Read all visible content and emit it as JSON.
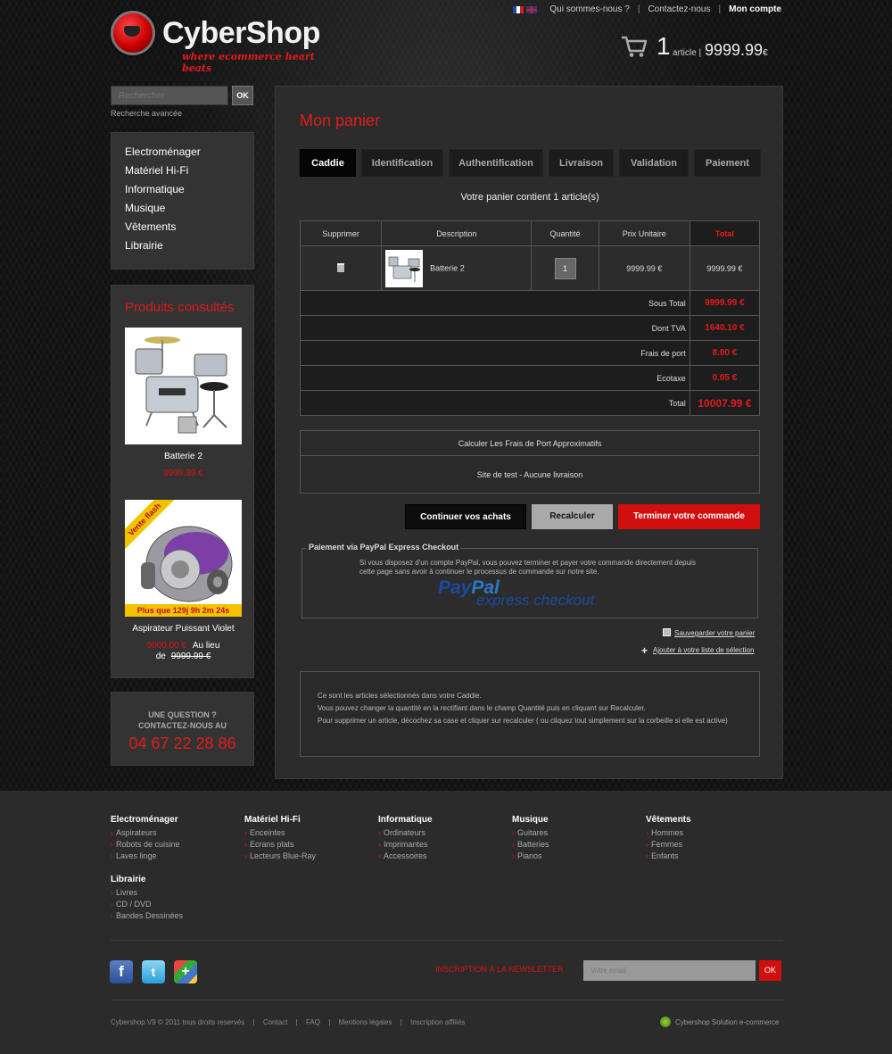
{
  "header": {
    "brand": "CyberShop",
    "tagline": "where ecommerce heart beats",
    "nav": [
      "Qui sommes-nous ?",
      "Contactez-nous",
      "Mon compte"
    ],
    "cart": {
      "count": "1",
      "word": "article |",
      "total": "9999.99",
      "currency": "€"
    }
  },
  "search": {
    "placeholder": "Rechercher",
    "button": "OK",
    "advanced": "Recherche avancée"
  },
  "categories": [
    "Electroménager",
    "Matériel Hi-Fi",
    "Informatique",
    "Musique",
    "Vêtements",
    "Librairie"
  ],
  "viewed": {
    "title": "Produits consultés",
    "items": [
      {
        "name": "Batterie 2",
        "price": "9999.99 €"
      },
      {
        "name": "Aspirateur Puissant Violet",
        "price": "9000.00 €",
        "au_lieu": "Au lieu",
        "de": "de",
        "old_price": "9999.99 €",
        "flash": "Vente flash",
        "countdown": "Plus que 129j 9h 2m 24s"
      }
    ]
  },
  "question": {
    "line1": "UNE QUESTION ?",
    "line2": "CONTACTEZ-NOUS AU",
    "phone": "04 67 22 28 86"
  },
  "main": {
    "title": "Mon panier",
    "steps": [
      "Caddie",
      "Identification",
      "Authentification",
      "Livraison",
      "Validation",
      "Paiement"
    ],
    "basket_count": "Votre panier contient 1 article(s)",
    "table": {
      "headers": [
        "Supprimer",
        "Description",
        "Quantité",
        "Prix Unitaire",
        "Total"
      ],
      "row": {
        "name": "Batterie 2",
        "qty": "1",
        "unit_price": "9999.99 €",
        "total": "9999.99 €"
      },
      "summary": [
        {
          "label": "Sous Total",
          "value": "9999.99 €"
        },
        {
          "label": "Dont TVA",
          "value": "1640.10 €"
        },
        {
          "label": "Frais de port",
          "value": "8.00 €"
        },
        {
          "label": "Ecotaxe",
          "value": "0.05 €"
        },
        {
          "label": "Total",
          "value": "10007.99 €"
        }
      ]
    },
    "shipping": {
      "title": "Calculer Les Frais de Port Approximatifs",
      "text": "Site de test - Aucune livraison"
    },
    "buttons": {
      "continue": "Continuer vos achats",
      "recalc": "Recalculer",
      "finish": "Terminer votre commande"
    },
    "paypal": {
      "title": "Paiement via PayPal Express Checkout",
      "text": "Si vous disposez d'un compte PayPal, vous pouvez terminer et payer votre commande directement depuis cette page sans avoir à continuer le processus de commande sur notre site.",
      "logo1": "Pay",
      "logo2": "Pal",
      "logo3": "express checkout"
    },
    "links": {
      "save": "Sauvegarder votre panier",
      "add": "Ajouter à votre liste de sélection"
    },
    "info": [
      "Ce sont les articles sélectionnés dans votre Caddie.",
      "Vous pouvez changer la quantité en la rectifiant dans le champ Quantité puis en cliquant sur Recalculer.",
      "Pour supprimer un article, décochez sa case et cliquer sur recalculer ( ou cliquez tout simplement sur la corbeille si elle est active)"
    ]
  },
  "footer": {
    "columns": [
      {
        "title": "Electroménager",
        "items": [
          "Aspirateurs",
          "Robots de cuisine",
          "Laves linge"
        ]
      },
      {
        "title": "Matériel Hi-Fi",
        "items": [
          "Enceintes",
          "Ecrans plats",
          "Lecteurs Blue-Ray"
        ]
      },
      {
        "title": "Informatique",
        "items": [
          "Ordinateurs",
          "Imprimantes",
          "Accessoires"
        ]
      },
      {
        "title": "Musique",
        "items": [
          "Guitares",
          "Batteries",
          "Pianos"
        ]
      },
      {
        "title": "Vêtements",
        "items": [
          "Hommes",
          "Femmes",
          "Enfants"
        ]
      },
      {
        "title": "Librairie",
        "items": [
          "Livres",
          "CD / DVD",
          "Bandes Dessinées"
        ]
      }
    ],
    "newsletter": {
      "label": "INSCRIPTION À LA NEWSLETTER",
      "placeholder": "Votre email",
      "button": "OK"
    },
    "copyright": "Cybershop V9 © 2011 tous droits reservés",
    "links": [
      "Contact",
      "FAQ",
      "Mentions légales",
      "Inscription affiliés"
    ],
    "solution": "Cybershop Solution e-commerce"
  }
}
